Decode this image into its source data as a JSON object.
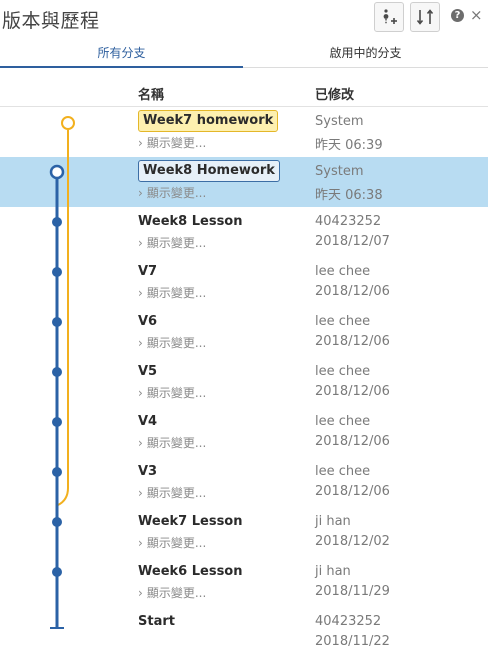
{
  "header": {
    "title": "版本與歷程",
    "branch_icon": "branch-add-icon",
    "compare_icon": "compare-icon",
    "help_label": "?",
    "close_label": "×"
  },
  "tabs": [
    {
      "label": "所有分支",
      "active": true
    },
    {
      "label": "啟用中的分支",
      "active": false
    }
  ],
  "columns": {
    "name": "名稱",
    "modified": "已修改"
  },
  "colors": {
    "main_branch": "#2b62a6",
    "side_branch": "#f2b01e",
    "selected_row": "#b8dcf2"
  },
  "versions": [
    {
      "name": "Week7 homework",
      "sub": "顯示變更...",
      "author": "System",
      "date": "昨天 06:39",
      "tag": "yellow",
      "selected": false
    },
    {
      "name": "Week8 Homework",
      "sub": "顯示變更...",
      "author": "System",
      "date": "昨天 06:38",
      "tag": "blue",
      "selected": true
    },
    {
      "name": "Week8 Lesson",
      "sub": "顯示變更...",
      "author": "40423252",
      "date": "2018/12/07",
      "tag": "",
      "selected": false
    },
    {
      "name": "V7",
      "sub": "顯示變更...",
      "author": "lee chee",
      "date": "2018/12/06",
      "tag": "",
      "selected": false
    },
    {
      "name": "V6",
      "sub": "顯示變更...",
      "author": "lee chee",
      "date": "2018/12/06",
      "tag": "",
      "selected": false
    },
    {
      "name": "V5",
      "sub": "顯示變更...",
      "author": "lee chee",
      "date": "2018/12/06",
      "tag": "",
      "selected": false
    },
    {
      "name": "V4",
      "sub": "顯示變更...",
      "author": "lee chee",
      "date": "2018/12/06",
      "tag": "",
      "selected": false
    },
    {
      "name": "V3",
      "sub": "顯示變更...",
      "author": "lee chee",
      "date": "2018/12/06",
      "tag": "",
      "selected": false
    },
    {
      "name": "Week7 Lesson",
      "sub": "顯示變更...",
      "author": "ji han",
      "date": "2018/12/02",
      "tag": "",
      "selected": false
    },
    {
      "name": "Week6 Lesson",
      "sub": "顯示變更...",
      "author": "ji han",
      "date": "2018/11/29",
      "tag": "",
      "selected": false
    },
    {
      "name": "Start",
      "sub": "",
      "author": "40423252",
      "date": "2018/11/22",
      "tag": "",
      "selected": false
    }
  ]
}
